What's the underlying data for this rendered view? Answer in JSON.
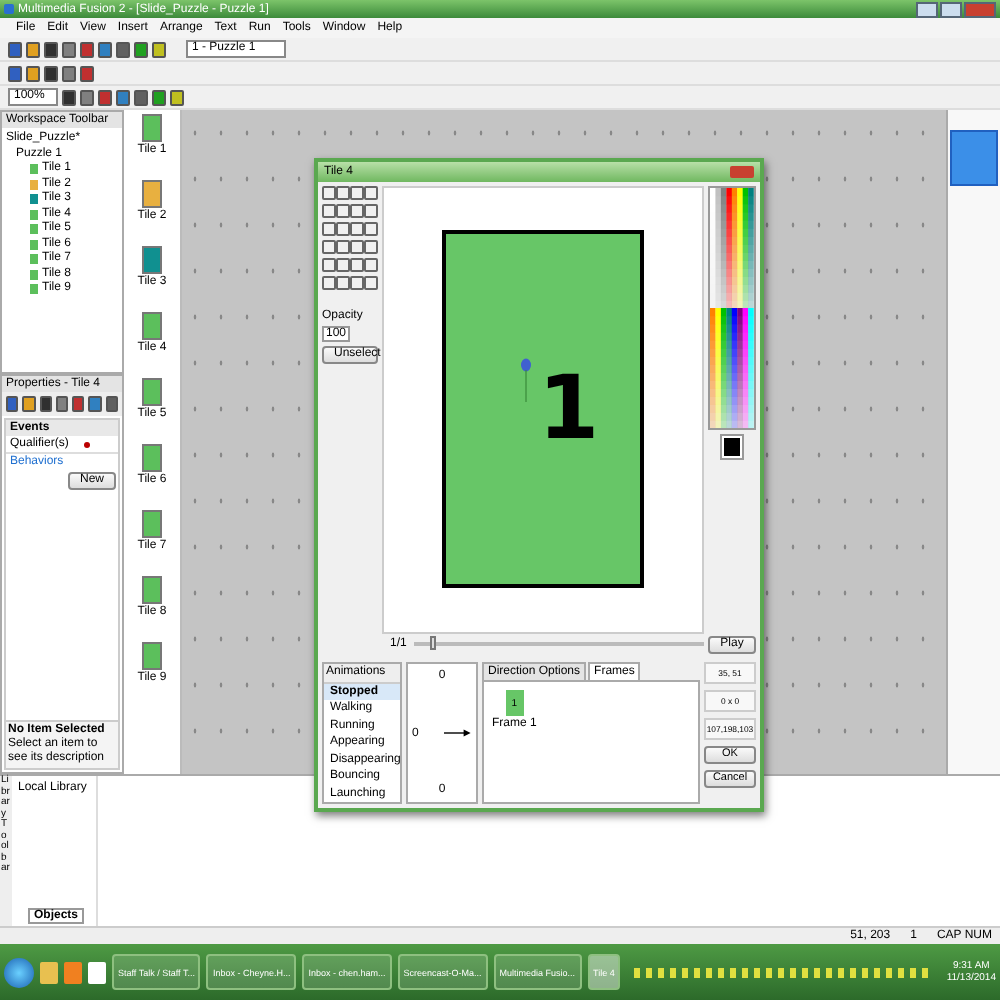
{
  "window": {
    "title": "Multimedia Fusion 2 - [Slide_Puzzle - Puzzle 1]"
  },
  "menu": [
    "File",
    "Edit",
    "View",
    "Insert",
    "Arrange",
    "Text",
    "Run",
    "Tools",
    "Window",
    "Help"
  ],
  "toolbar": {
    "frame_select": "1 - Puzzle 1",
    "zoom": "100%"
  },
  "workspace": {
    "title": "Workspace Toolbar",
    "root": "Slide_Puzzle*",
    "frame": "Puzzle 1",
    "tiles": [
      {
        "label": "Tile 1",
        "color": "#5cbf5c"
      },
      {
        "label": "Tile 2",
        "color": "#e8b040"
      },
      {
        "label": "Tile 3",
        "color": "#109090"
      },
      {
        "label": "Tile 4",
        "color": "#5cbf5c"
      },
      {
        "label": "Tile 5",
        "color": "#5cbf5c"
      },
      {
        "label": "Tile 6",
        "color": "#5cbf5c"
      },
      {
        "label": "Tile 7",
        "color": "#5cbf5c"
      },
      {
        "label": "Tile 8",
        "color": "#5cbf5c"
      },
      {
        "label": "Tile 9",
        "color": "#5cbf5c"
      }
    ]
  },
  "strip_tiles": [
    {
      "label": "Tile 1",
      "color": "#5cbf5c"
    },
    {
      "label": "Tile 2",
      "color": "#e8b040"
    },
    {
      "label": "Tile 3",
      "color": "#109090"
    },
    {
      "label": "Tile 4",
      "color": "#5cbf5c"
    },
    {
      "label": "Tile 5",
      "color": "#5cbf5c"
    },
    {
      "label": "Tile 6",
      "color": "#5cbf5c"
    },
    {
      "label": "Tile 7",
      "color": "#5cbf5c"
    },
    {
      "label": "Tile 8",
      "color": "#5cbf5c"
    },
    {
      "label": "Tile 9",
      "color": "#5cbf5c"
    }
  ],
  "properties": {
    "title": "Properties - Tile 4",
    "section": "Events",
    "qualifier_label": "Qualifier(s)",
    "behaviors_label": "Behaviors",
    "new_button": "New",
    "info_title": "No Item Selected",
    "info_text": "Select an item to see its description"
  },
  "dialog": {
    "title": "Tile 4",
    "opacity_label": "Opacity",
    "opacity": "100",
    "unselect_button": "Unselect",
    "image_text": "1",
    "frame_counter": "1/1",
    "timeline": {
      "level": 0.05
    },
    "play_button": "Play",
    "animations_header": "Animations",
    "animations": [
      {
        "label": "Stopped",
        "selected": true
      },
      {
        "label": "Walking",
        "selected": false
      },
      {
        "label": "Running",
        "selected": false
      },
      {
        "label": "Appearing",
        "selected": false
      },
      {
        "label": "Disappearing",
        "selected": false
      },
      {
        "label": "Bouncing",
        "selected": false
      },
      {
        "label": "Launching",
        "selected": false
      }
    ],
    "direction_labels": [
      "0",
      "0",
      "0"
    ],
    "tabs": [
      {
        "label": "Direction Options",
        "selected": false
      },
      {
        "label": "Frames",
        "selected": true
      }
    ],
    "frame_thumb": {
      "label": "Frame 1",
      "text": "1"
    },
    "readouts": [
      "35, 51",
      "0 x 0",
      "107,198,103"
    ],
    "ok_button": "OK",
    "cancel_button": "Cancel"
  },
  "library": {
    "side_title": "Library Toolbar",
    "item": "Local Library",
    "tab": "Objects"
  },
  "status_bar": [
    "51, 203",
    "1",
    "CAP NUM"
  ],
  "taskbar": {
    "tasks": [
      {
        "label": "Staff Talk / Staff T...",
        "selected": false
      },
      {
        "label": "Inbox - Cheyne.H...",
        "selected": false
      },
      {
        "label": "Inbox - chen.ham...",
        "selected": false
      },
      {
        "label": "Screencast-O-Ma...",
        "selected": false
      },
      {
        "label": "Multimedia Fusio...",
        "selected": false
      },
      {
        "label": "Tile 4",
        "selected": true
      }
    ],
    "time": "9:31 AM",
    "date": "11/13/2014"
  }
}
